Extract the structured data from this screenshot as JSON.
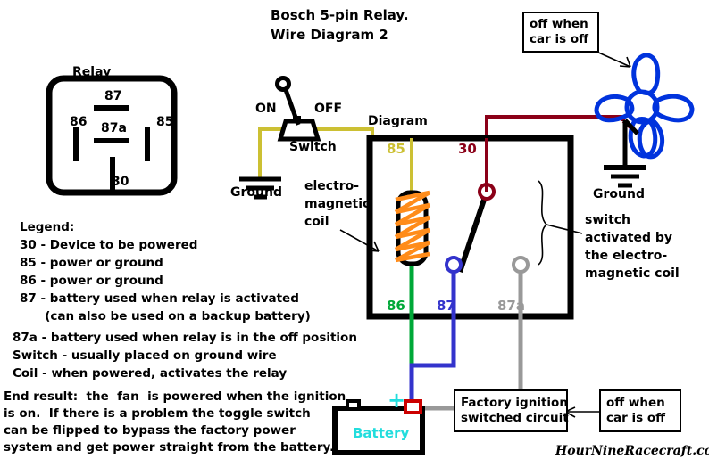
{
  "title": {
    "line1": "Bosch 5-pin Relay.",
    "line2": "Wire Diagram 2"
  },
  "relay_pinout": {
    "heading": "Relay",
    "pins": {
      "p87": "87",
      "p86": "86",
      "p85": "85",
      "p87a": "87a",
      "p30": "30"
    }
  },
  "legend": {
    "heading": "Legend:",
    "items": [
      "30 - Device to be powered",
      "85 - power or ground",
      "86 - power or ground",
      "87 - battery used when relay is activated",
      "      (can also be used on a backup battery)",
      "87a - battery used when relay is in the off position",
      "Switch - usually placed on ground wire",
      "Coil - when powered, activates the relay"
    ]
  },
  "end_result": {
    "lines": [
      "End result:  the  fan  is powered when the ignition",
      "is on.  If there is a problem the toggle switch",
      "can be flipped to bypass the factory power",
      "system and get power straight from the battery."
    ]
  },
  "switch_block": {
    "on_label": "ON",
    "off_label": "OFF",
    "name_label": "Switch",
    "ground_label": "Ground"
  },
  "diagram_box": {
    "label": "Diagram",
    "terminals": [
      {
        "id": "85",
        "label": "85",
        "color": "#ccc033"
      },
      {
        "id": "30",
        "label": "30",
        "color": "#8b0018"
      },
      {
        "id": "86",
        "label": "86",
        "color": "#00a838"
      },
      {
        "id": "87",
        "label": "87",
        "color": "#3333cc"
      },
      {
        "id": "87a",
        "label": "87a",
        "color": "#999999"
      }
    ],
    "coil_label": {
      "l1": "electro-",
      "l2": "magnetic",
      "l3": "coil"
    },
    "switch_note": {
      "l1": "switch",
      "l2": "activated by",
      "l3": "the electro-",
      "l4": "magnetic coil"
    }
  },
  "fan": {
    "ground_label": "Ground"
  },
  "battery": {
    "label": "Battery",
    "plus": "+"
  },
  "callouts": {
    "fan_off": {
      "l1": "off when",
      "l2": "car is off"
    },
    "ignition": {
      "l1": "Factory ignition",
      "l2": "switched circuit"
    },
    "ignition_off": {
      "l1": "off when",
      "l2": "car is off"
    }
  },
  "watermark": "HourNineRacecraft.com",
  "colors": {
    "wire_olive": "#ccc033",
    "wire_darkred": "#8b0018",
    "wire_green": "#00a838",
    "wire_blue": "#3333cc",
    "wire_gray": "#999999",
    "coil_orange": "#ff8c1a",
    "fan_blue": "#0033dd",
    "battery_cyan": "#22dddd",
    "black": "#000000"
  }
}
